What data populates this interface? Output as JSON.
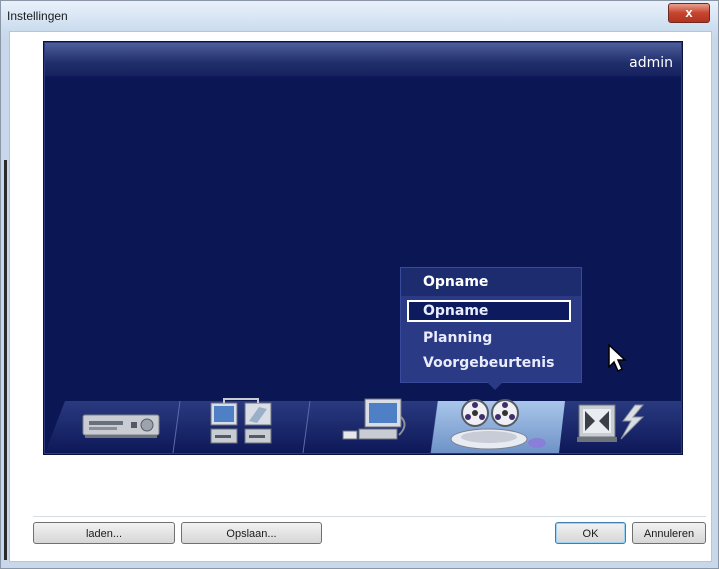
{
  "window": {
    "title": "Instellingen",
    "close_glyph": "x"
  },
  "panel": {
    "user": "admin"
  },
  "menu": {
    "header": "Opname",
    "items": [
      {
        "label": "Opname",
        "selected": true
      },
      {
        "label": "Planning",
        "selected": false
      },
      {
        "label": "Voorgebeurtenis",
        "selected": false
      }
    ]
  },
  "dock": {
    "items": [
      {
        "icon": "av-receiver-icon"
      },
      {
        "icon": "network-devices-icon"
      },
      {
        "icon": "computer-device-icon"
      },
      {
        "icon": "recording-reels-icon",
        "active": true
      },
      {
        "icon": "event-alarm-icon"
      }
    ]
  },
  "buttons": {
    "load": "laden...",
    "save": "Opslaan...",
    "ok": "OK",
    "cancel": "Annuleren"
  },
  "colors": {
    "panel_bg": "#0b1655",
    "menu_bg": "#2a3a84",
    "active_tab": "#8ab0df"
  }
}
